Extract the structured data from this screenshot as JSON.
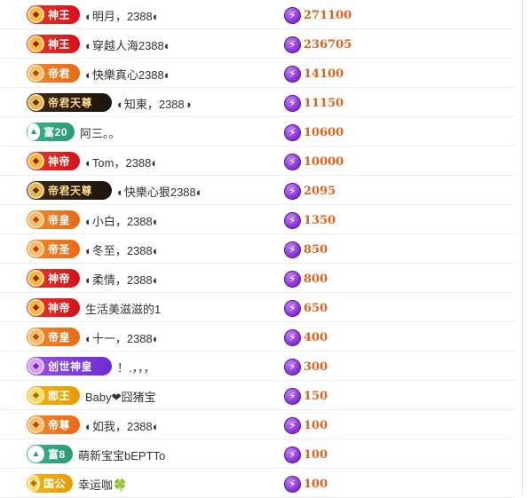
{
  "rows": [
    {
      "badge": "神王",
      "style": "b-shen",
      "name": "◐明月，2388◐",
      "score": "271100"
    },
    {
      "badge": "神王",
      "style": "b-shen",
      "name": "◐穿越人海2388◐",
      "score": "236705"
    },
    {
      "badge": "帝君",
      "style": "b-diwang",
      "name": "◐快樂真心2388◐",
      "score": "14100"
    },
    {
      "badge": "帝君天尊",
      "style": "b-dark",
      "name": "◐知東，2388◑",
      "score": "11150"
    },
    {
      "badge": "富20",
      "style": "b-fu",
      "name": "阿三。。",
      "score": "10600"
    },
    {
      "badge": "神帝",
      "style": "b-shen",
      "name": "◐Tom，2388◐",
      "score": "10000"
    },
    {
      "badge": "帝君天尊",
      "style": "b-dark",
      "name": "◐快樂心狠2388◐",
      "score": "2095"
    },
    {
      "badge": "帝皇",
      "style": "b-diwang",
      "name": "◐小白，2388◐",
      "score": "1350"
    },
    {
      "badge": "帝圣",
      "style": "b-diwang",
      "name": "◐冬至，2388◐",
      "score": "850"
    },
    {
      "badge": "神帝",
      "style": "b-shen",
      "name": "◐柔情，2388◐",
      "score": "800"
    },
    {
      "badge": "神帝",
      "style": "b-shen",
      "name": "生活美滋滋的1",
      "score": "650"
    },
    {
      "badge": "帝皇",
      "style": "b-diwang",
      "name": "◐十一，2388◐",
      "score": "400"
    },
    {
      "badge": "创世神皇",
      "style": "b-chuang",
      "name": "！.，，，",
      "score": "300"
    },
    {
      "badge": "郡王",
      "style": "b-jun",
      "name": "Baby❤囧猪宝",
      "score": "150"
    },
    {
      "badge": "帝尊",
      "style": "b-diwang",
      "name": "◐如我，2388◐",
      "score": "100"
    },
    {
      "badge": "富8",
      "style": "b-fu",
      "name": "萌新宝宝bEPTTo",
      "score": "100"
    },
    {
      "badge": "国公",
      "style": "b-jun",
      "name": "幸运咖🍀",
      "score": "100"
    }
  ],
  "icons": {
    "medal": "medal-icon",
    "bolt": "lightning-icon"
  },
  "colors": {
    "score": "#e0611a",
    "bolt": "#7b2bd0"
  }
}
